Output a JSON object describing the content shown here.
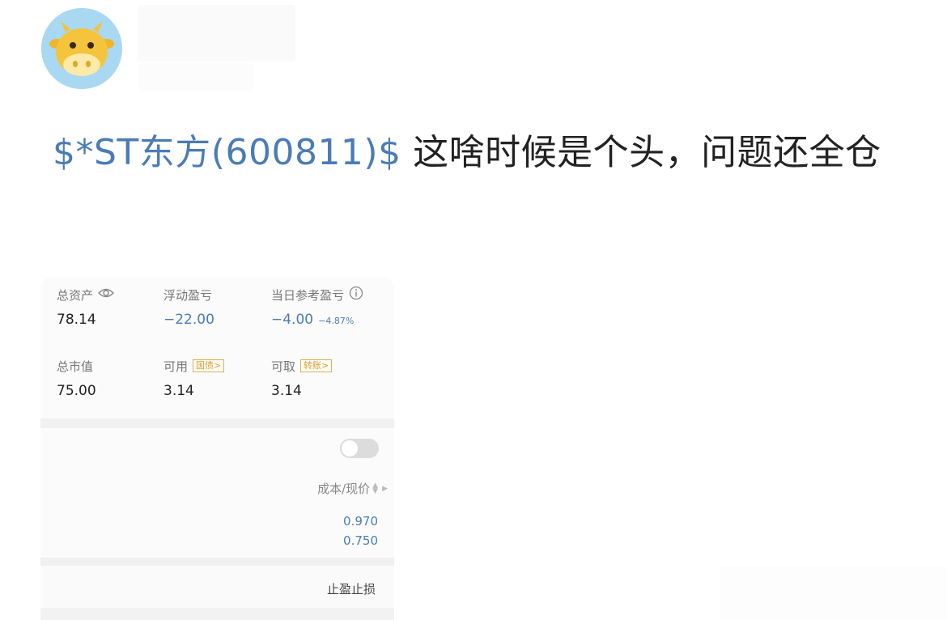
{
  "post": {
    "stock_link": "$*ST东方(600811)$",
    "text": " 这啥时候是个头，问题还全仓"
  },
  "account": {
    "total_assets_label": "总资产",
    "total_assets_value": "78.14",
    "floating_pl_label": "浮动盈亏",
    "floating_pl_value": "−22.00",
    "today_pl_label": "当日参考盈亏",
    "today_pl_value": "−4.00",
    "today_pl_pct": "−4.87%",
    "market_value_label": "总市值",
    "market_value_value": "75.00",
    "available_label": "可用",
    "available_tag": "国债>",
    "available_value": "3.14",
    "withdrawable_label": "可取",
    "withdrawable_tag": "转账>",
    "withdrawable_value": "3.14"
  },
  "positions": {
    "sort_header": "成本/现价",
    "cost_price": "0.970",
    "current_price": "0.750",
    "stop_label": "止盈止损",
    "toggle_on": false
  },
  "colors": {
    "accent": "#4a7cb7",
    "tag": "#d9a02c",
    "avatar_bg": "#a9d8f2"
  },
  "icons": [
    "cow-avatar-icon",
    "eye-icon",
    "info-icon",
    "sort-arrows-icon",
    "play-triangle-icon"
  ]
}
